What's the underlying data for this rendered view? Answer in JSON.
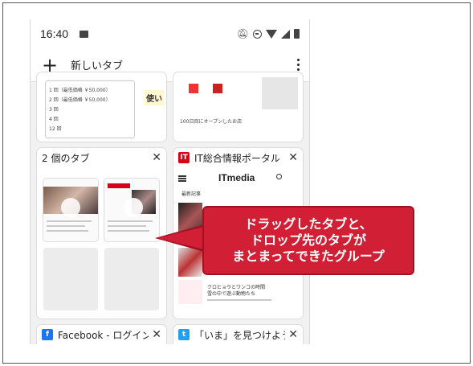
{
  "status": {
    "time": "16:40"
  },
  "toolbar": {
    "new_tab": "新しいタブ"
  },
  "tabs": {
    "group": {
      "label": "2 個のタブ",
      "close": "✕"
    },
    "itmedia": {
      "label": "IT総合情報ポータル",
      "close": "✕",
      "fav": "IT",
      "logo": "ITmedia",
      "section": "最新記事"
    },
    "facebook": {
      "label": "Facebook - ログイン",
      "close": "✕"
    },
    "twitter": {
      "label": "「いま」を見つけよう",
      "close": "✕"
    }
  },
  "top_tab": {
    "rows": [
      "1 回（最低価格 ￥50,000）",
      "2 回（最低価格 ￥50,000）",
      "3 回",
      "4 回",
      "12 回"
    ],
    "side_text": "使い",
    "caption": "100日目にオープンしたお店"
  },
  "itmedia_articles": [
    "クロヒョウとワンコの時間",
    "雪の中で遊ぶ動物たち"
  ],
  "callout": {
    "line1": "ドラッグしたタブと、",
    "line2": "ドロップ先のタブが",
    "line3": "まとまってできたグループ"
  },
  "colors": {
    "accent": "#d11f36",
    "itmedia_red": "#d7001a",
    "facebook_blue": "#1877f2",
    "twitter_blue": "#1da1f2"
  }
}
